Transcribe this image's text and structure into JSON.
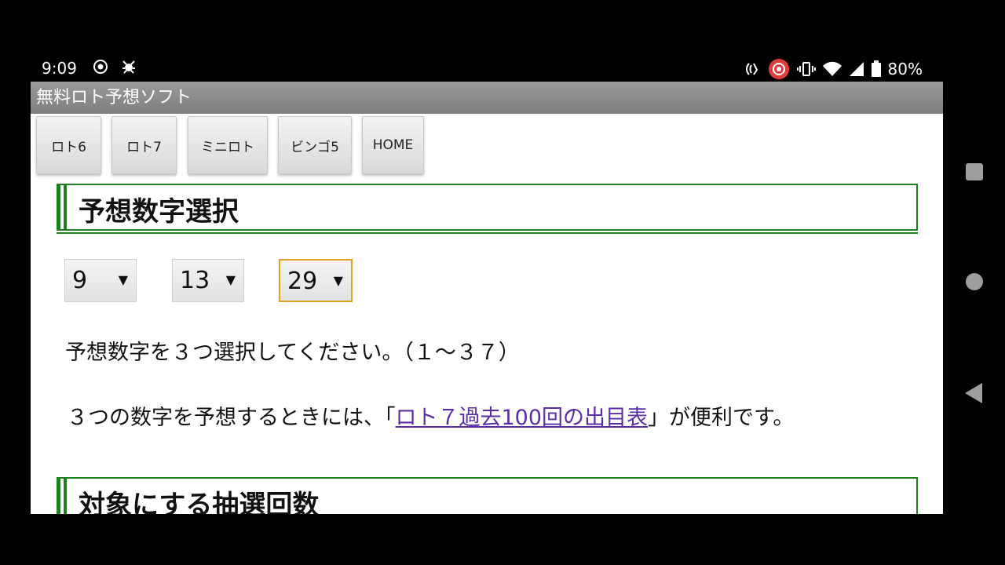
{
  "status_bar": {
    "time": "9:09",
    "battery": "80%"
  },
  "app": {
    "title": "無料ロト予想ソフト"
  },
  "nav": {
    "buttons": [
      "ロト6",
      "ロト7",
      "ミニロト",
      "ビンゴ5",
      "HOME"
    ]
  },
  "section1": {
    "heading": "予想数字選択",
    "selects": [
      "9",
      "13",
      "29"
    ],
    "instruction": "予想数字を３つ選択してください。（１～３７）",
    "hint_before": "３つの数字を予想するときには、「",
    "hint_link": "ロト７過去100回の出目表",
    "hint_after": "」が便利です。"
  },
  "section2": {
    "heading": "対象にする抽選回数"
  },
  "colors": {
    "accent_green": "#1f7f1f",
    "focus_orange": "#e0a326",
    "link_purple": "#5a2ea6",
    "titlebar_gray": "#8c8c8c"
  }
}
